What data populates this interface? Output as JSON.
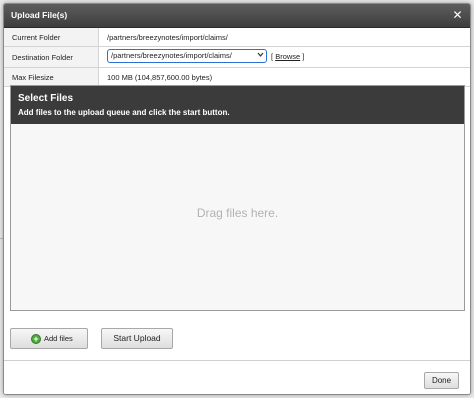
{
  "dialog": {
    "title": "Upload File(s)",
    "close_glyph": "✕"
  },
  "info": {
    "current_folder_label": "Current Folder",
    "current_folder_value": "/partners/breezynotes/import/claims/",
    "destination_folder_label": "Destination Folder",
    "destination_folder_selected": "/partners/breezynotes/import/claims/",
    "browse_bracket_open": "[",
    "browse_label": "Browse",
    "browse_bracket_close": "]",
    "max_filesize_label": "Max Filesize",
    "max_filesize_value": "100 MB (104,857,600.00 bytes)"
  },
  "uploader": {
    "title": "Select Files",
    "subtitle": "Add files to the upload queue and click the start button.",
    "drop_text": "Drag files here."
  },
  "buttons": {
    "add_files": "Add files",
    "start_upload": "Start Upload",
    "done": "Done"
  },
  "icons": {
    "close": "close-icon",
    "add": "plus-circle-icon",
    "dropdown": "chevron-down-icon"
  },
  "colors": {
    "titlebar": "#4a4a4a",
    "uploader_header": "#3b3b3b",
    "select_focus": "#2f6fd2",
    "add_icon": "#4caa3a"
  }
}
